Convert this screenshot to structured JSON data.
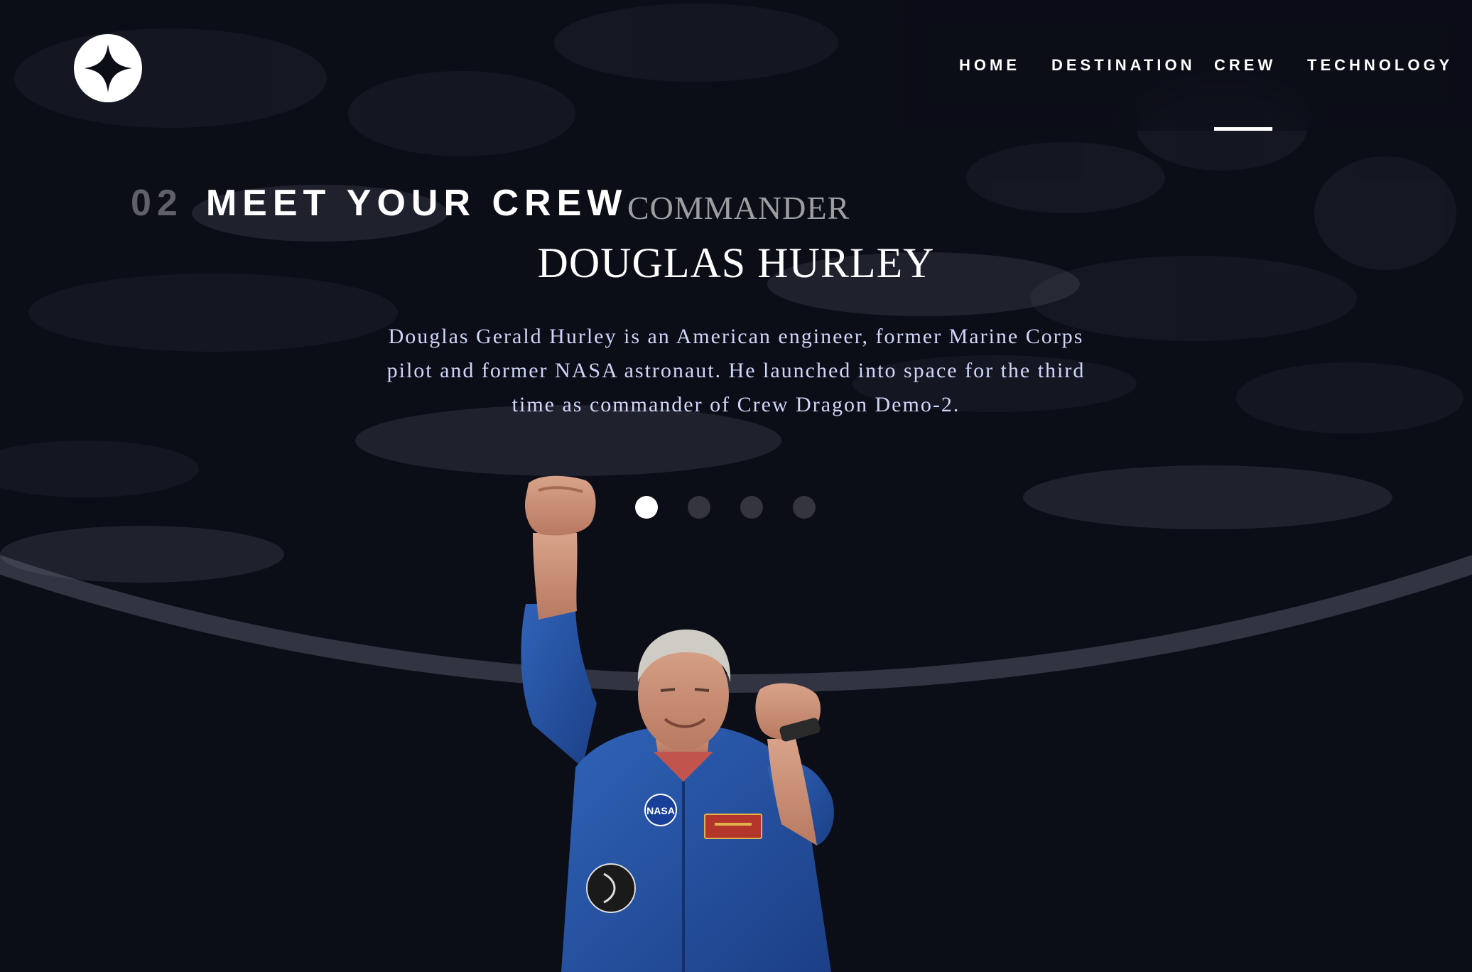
{
  "nav": {
    "items": [
      {
        "label": "HOME"
      },
      {
        "label": "DESTINATION"
      },
      {
        "label": "CREW",
        "active": true
      },
      {
        "label": "TECHNOLOGY"
      }
    ]
  },
  "heading": {
    "number": "02",
    "title": "MEET YOUR CREW"
  },
  "crew": {
    "role": "COMMANDER",
    "name": "DOUGLAS HURLEY",
    "bio": "Douglas Gerald Hurley is an American engineer, former Marine Corps pilot and former NASA astronaut. He launched into space for the third time as commander of Crew Dragon Demo-2.",
    "patch_label": "NASA"
  },
  "pagination": {
    "count": 4,
    "active_index": 0
  },
  "colors": {
    "background": "#0b0d17",
    "nav_background": "#151828",
    "text_light": "#d0d6f9",
    "white": "#ffffff"
  },
  "icons": {
    "logo": "star-logo-icon"
  }
}
